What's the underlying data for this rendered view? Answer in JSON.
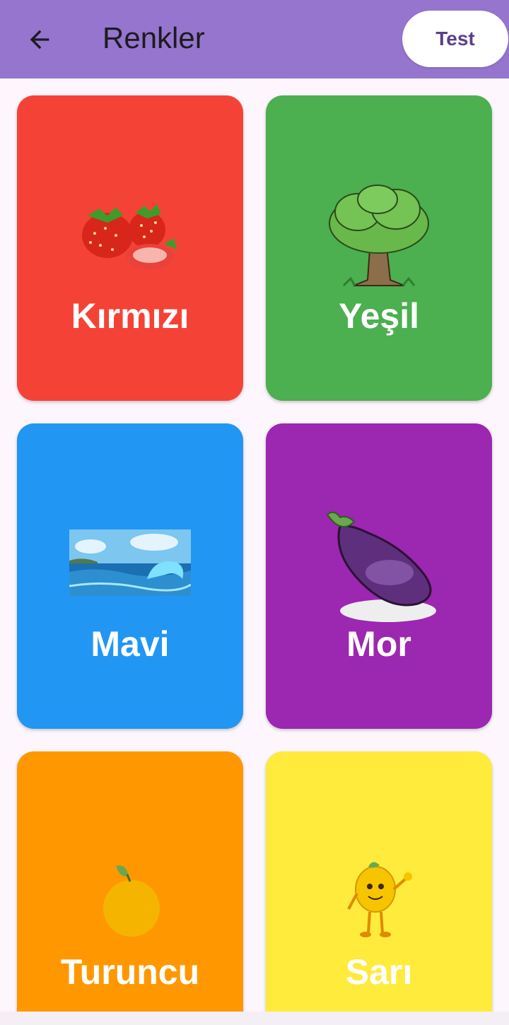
{
  "appbar": {
    "title": "Renkler",
    "test_label": "Test",
    "color": "#9575cd"
  },
  "cards": [
    {
      "label": "Kırmızı",
      "color": "#f44336",
      "icon": "strawberry-icon"
    },
    {
      "label": "Yeşil",
      "color": "#4caf50",
      "icon": "tree-icon"
    },
    {
      "label": "Mavi",
      "color": "#2196f3",
      "icon": "sea-wave-icon"
    },
    {
      "label": "Mor",
      "color": "#9c27b0",
      "icon": "eggplant-icon"
    },
    {
      "label": "Turuncu",
      "color": "#ff9800",
      "icon": "orange-fruit-icon"
    },
    {
      "label": "Sarı",
      "color": "#ffeb3b",
      "icon": "lemon-character-icon"
    }
  ]
}
